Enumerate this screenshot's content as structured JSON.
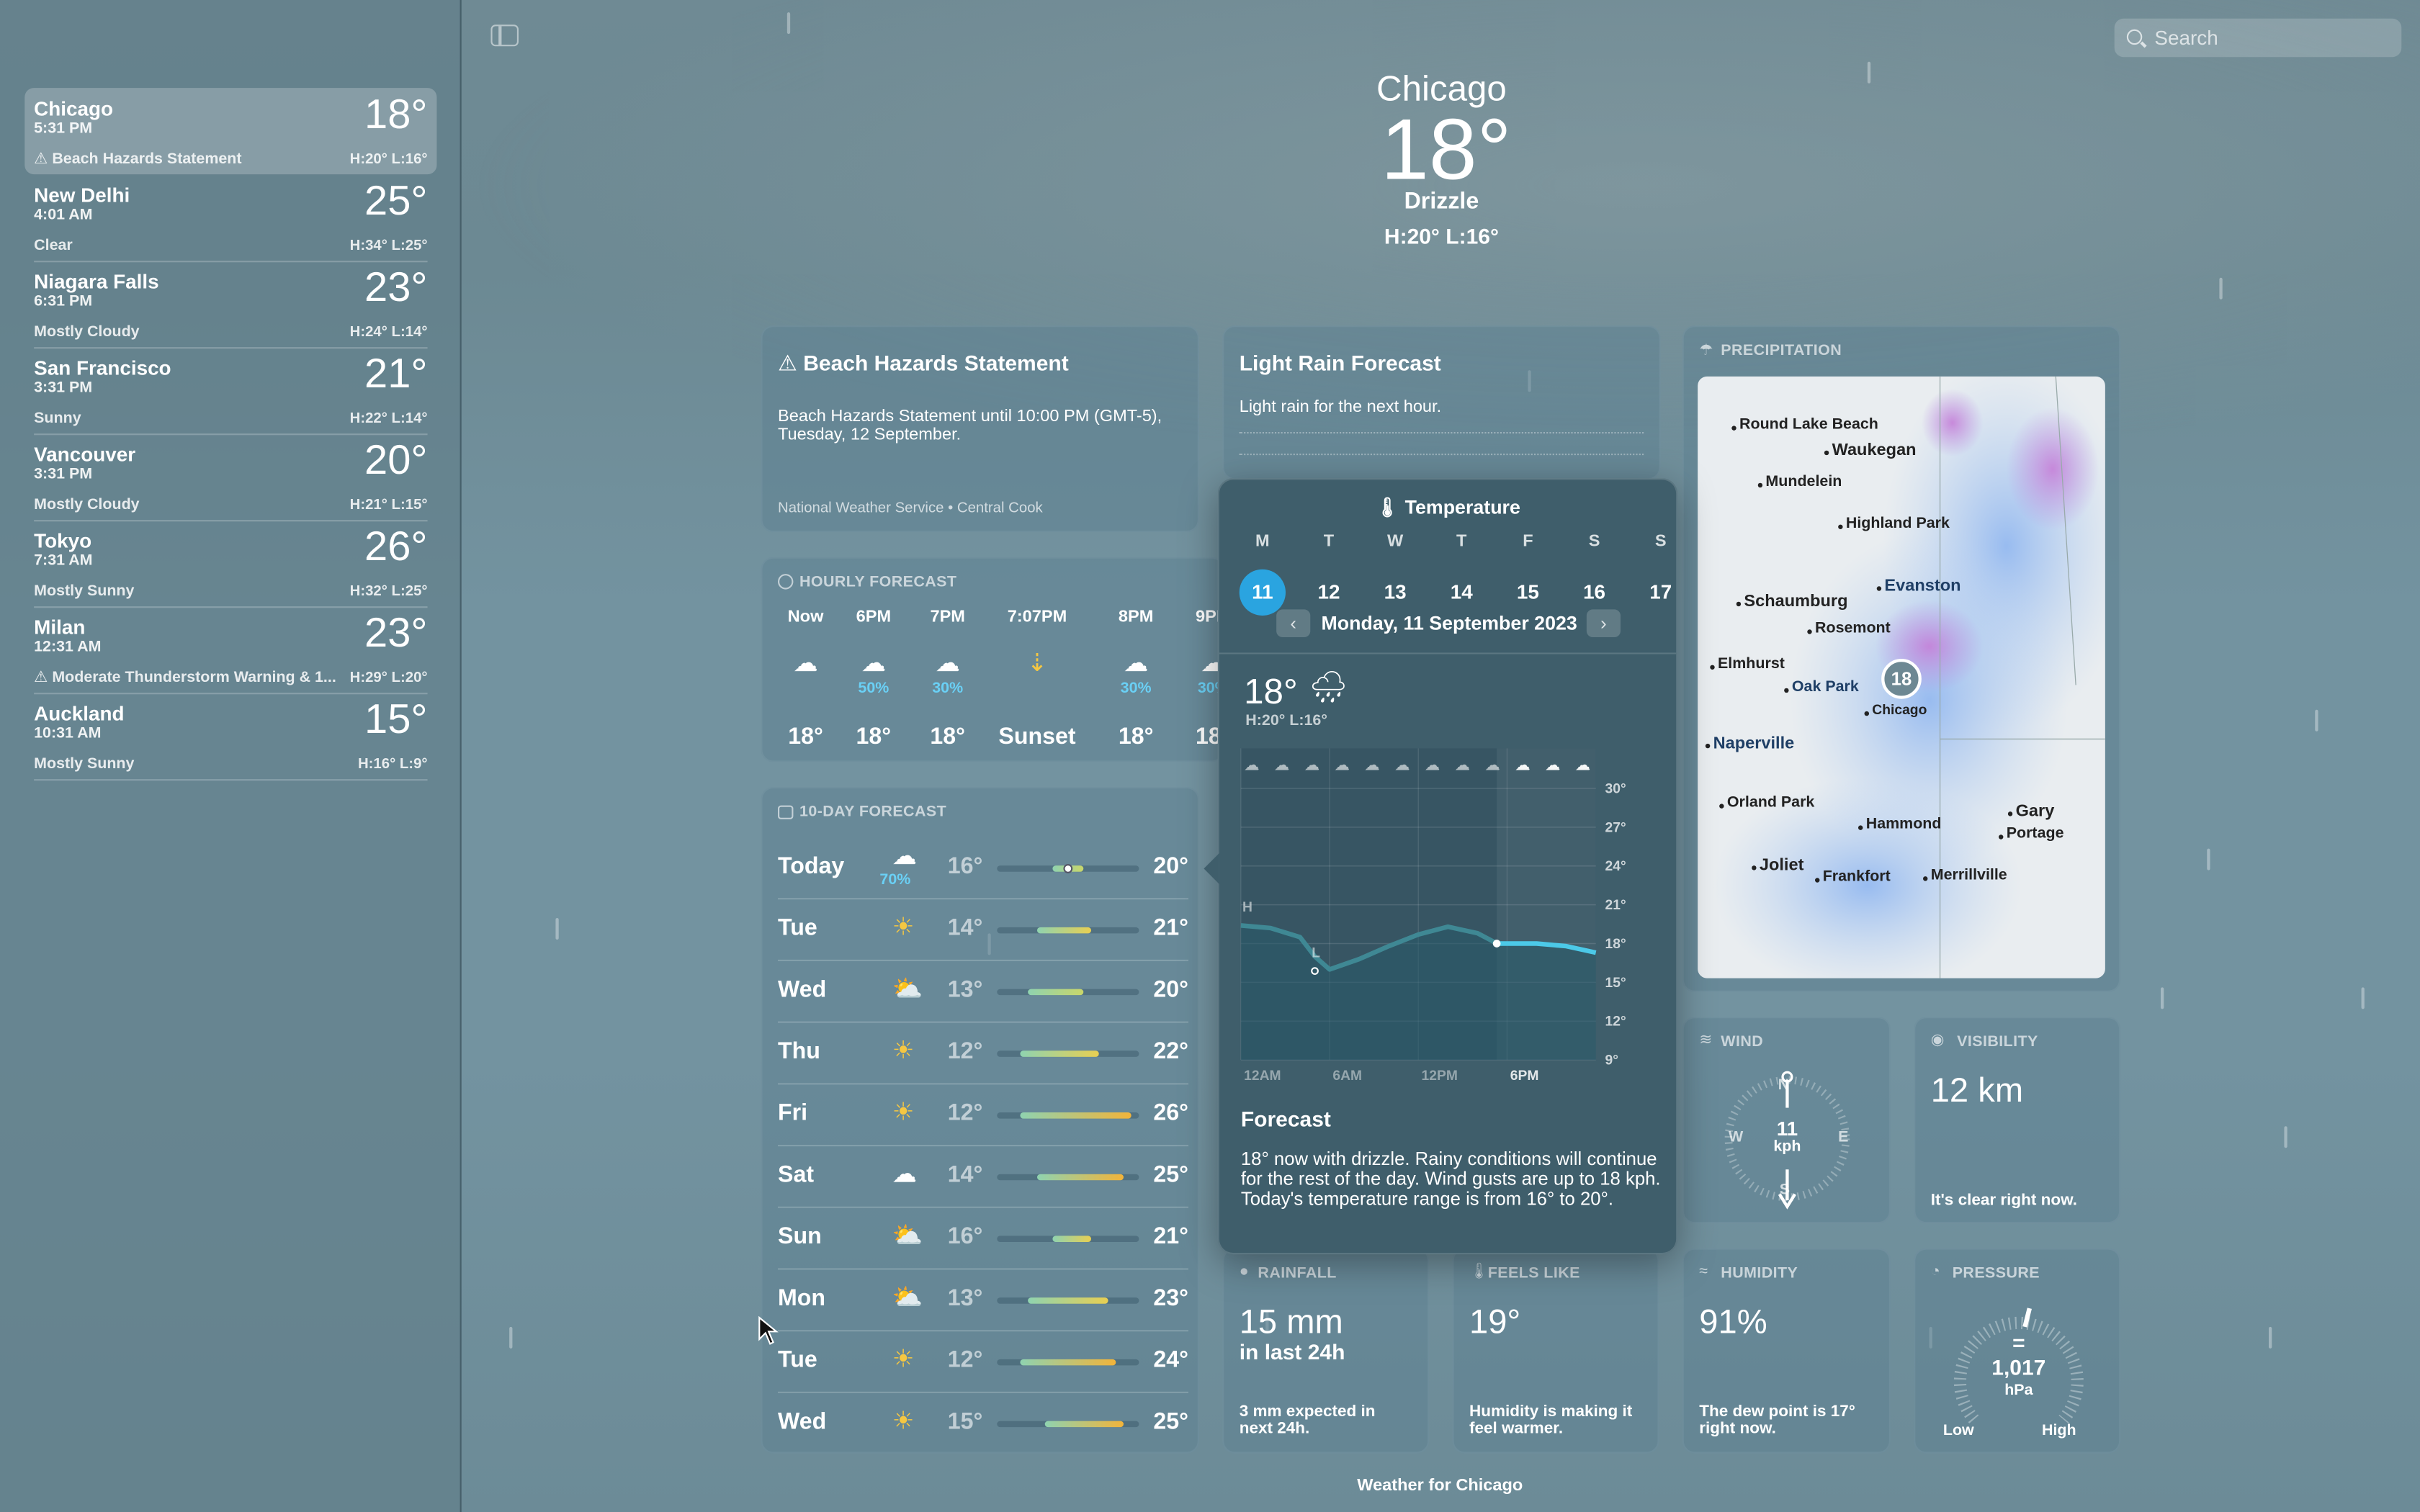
{
  "sidebar": {
    "cities": [
      {
        "name": "Chicago",
        "time": "5:31 PM",
        "temp": "18°",
        "condition": "Beach Hazards Statement",
        "hl": "H:20° L:16°",
        "alert": true
      },
      {
        "name": "New Delhi",
        "time": "4:01 AM",
        "temp": "25°",
        "condition": "Clear",
        "hl": "H:34° L:25°",
        "alert": false
      },
      {
        "name": "Niagara Falls",
        "time": "6:31 PM",
        "temp": "23°",
        "condition": "Mostly Cloudy",
        "hl": "H:24° L:14°",
        "alert": false
      },
      {
        "name": "San Francisco",
        "time": "3:31 PM",
        "temp": "21°",
        "condition": "Sunny",
        "hl": "H:22° L:14°",
        "alert": false
      },
      {
        "name": "Vancouver",
        "time": "3:31 PM",
        "temp": "20°",
        "condition": "Mostly Cloudy",
        "hl": "H:21° L:15°",
        "alert": false
      },
      {
        "name": "Tokyo",
        "time": "7:31 AM",
        "temp": "26°",
        "condition": "Mostly Sunny",
        "hl": "H:32° L:25°",
        "alert": false
      },
      {
        "name": "Milan",
        "time": "12:31 AM",
        "temp": "23°",
        "condition": "Moderate Thunderstorm Warning & 1...",
        "hl": "H:29° L:20°",
        "alert": true
      },
      {
        "name": "Auckland",
        "time": "10:31 AM",
        "temp": "15°",
        "condition": "Mostly Sunny",
        "hl": "H:16° L:9°",
        "alert": false
      }
    ]
  },
  "search": {
    "placeholder": "Search"
  },
  "header": {
    "city": "Chicago",
    "temp": "18°",
    "condition": "Drizzle",
    "hl": "H:20°  L:16°"
  },
  "alert_card": {
    "title": "Beach Hazards Statement",
    "body": "Beach Hazards Statement until 10:00 PM (GMT-5), Tuesday, 12 September.",
    "source": "National Weather Service • Central Cook"
  },
  "rain_card": {
    "title": "Light Rain Forecast",
    "body": "Light rain for the next hour."
  },
  "hourly": {
    "title": "HOURLY FORECAST",
    "hours": [
      {
        "label": "Now",
        "icon": "cloud-icon",
        "pop": "",
        "temp": "18°"
      },
      {
        "label": "6PM",
        "icon": "rain-cloud-icon",
        "pop": "50%",
        "temp": "18°"
      },
      {
        "label": "7PM",
        "icon": "rain-cloud-icon",
        "pop": "30%",
        "temp": "18°"
      },
      {
        "label": "7:07PM",
        "icon": "sunset-icon",
        "pop": "",
        "temp": "Sunset"
      },
      {
        "label": "8PM",
        "icon": "moon-cloud-icon",
        "pop": "30%",
        "temp": "18°"
      },
      {
        "label": "9PM",
        "icon": "rain-cloud-icon",
        "pop": "30%",
        "temp": "18°"
      }
    ]
  },
  "ten_day": {
    "title": "10-DAY FORECAST",
    "days": [
      {
        "day": "Today",
        "icon": "rain-cloud-icon",
        "pop": "70%",
        "lo": "16°",
        "hi": "20°",
        "lo_v": 16,
        "hi_v": 20,
        "current": 18
      },
      {
        "day": "Tue",
        "icon": "sun-icon",
        "pop": "",
        "lo": "14°",
        "hi": "21°",
        "lo_v": 14,
        "hi_v": 21
      },
      {
        "day": "Wed",
        "icon": "partly-cloudy-icon",
        "pop": "",
        "lo": "13°",
        "hi": "20°",
        "lo_v": 13,
        "hi_v": 20
      },
      {
        "day": "Thu",
        "icon": "sun-icon",
        "pop": "",
        "lo": "12°",
        "hi": "22°",
        "lo_v": 12,
        "hi_v": 22
      },
      {
        "day": "Fri",
        "icon": "sun-icon",
        "pop": "",
        "lo": "12°",
        "hi": "26°",
        "lo_v": 12,
        "hi_v": 26
      },
      {
        "day": "Sat",
        "icon": "cloud-icon",
        "pop": "",
        "lo": "14°",
        "hi": "25°",
        "lo_v": 14,
        "hi_v": 25
      },
      {
        "day": "Sun",
        "icon": "partly-cloudy-icon",
        "pop": "",
        "lo": "16°",
        "hi": "21°",
        "lo_v": 16,
        "hi_v": 21
      },
      {
        "day": "Mon",
        "icon": "partly-cloudy-icon",
        "pop": "",
        "lo": "13°",
        "hi": "23°",
        "lo_v": 13,
        "hi_v": 23
      },
      {
        "day": "Tue",
        "icon": "sun-icon",
        "pop": "",
        "lo": "12°",
        "hi": "24°",
        "lo_v": 12,
        "hi_v": 24
      },
      {
        "day": "Wed",
        "icon": "sun-icon",
        "pop": "",
        "lo": "15°",
        "hi": "25°",
        "lo_v": 15,
        "hi_v": 25
      }
    ]
  },
  "popover": {
    "title": "Temperature",
    "weekdays": [
      "M",
      "T",
      "W",
      "T",
      "F",
      "S",
      "S"
    ],
    "dates": [
      "11",
      "12",
      "13",
      "14",
      "15",
      "16",
      "17"
    ],
    "selected_index": 0,
    "date_label": "Monday, 11 September 2023",
    "temp": "18°",
    "hl": "H:20° L:16°",
    "y_ticks": [
      "30°",
      "27°",
      "24°",
      "21°",
      "18°",
      "15°",
      "12°",
      "9°"
    ],
    "x_ticks": [
      "12AM",
      "6AM",
      "12PM",
      "6PM"
    ],
    "h_marker": "H",
    "l_marker": "L",
    "forecast_title": "Forecast",
    "forecast_text": "18° now with drizzle. Rainy conditions will continue for the rest of the day. Wind gusts are up to 18 kph. Today's temperature range is from 16° to 20°."
  },
  "chart_data": {
    "type": "line",
    "title": "Temperature",
    "x": [
      "12AM",
      "2AM",
      "4AM",
      "5AM",
      "6AM",
      "8AM",
      "10AM",
      "12PM",
      "2PM",
      "4PM",
      "5PM",
      "6PM",
      "8PM",
      "10PM",
      "12AM"
    ],
    "x_hours": [
      0,
      2,
      4,
      5,
      6,
      8,
      10,
      12,
      14,
      16,
      17,
      18,
      20,
      22,
      24
    ],
    "series": [
      {
        "values": [
          19.4,
          19.2,
          18.5,
          17.0,
          16.0,
          16.8,
          17.8,
          18.7,
          19.3,
          18.8,
          18.2,
          18.0,
          18.0,
          17.8,
          17.3
        ]
      }
    ],
    "current_hour": 17.3,
    "ylim": [
      9,
      30
    ],
    "y_ticks": [
      9,
      12,
      15,
      18,
      21,
      24,
      27,
      30
    ],
    "grid": true
  },
  "precipitation": {
    "title": "PRECIPITATION",
    "map_places": [
      "Round Lake Beach",
      "Waukegan",
      "Mundelein",
      "Highland Park",
      "Schaumburg",
      "Evanston",
      "Rosemont",
      "Elmhurst",
      "Oak Park",
      "Naperville",
      "Chicago",
      "Orland Park",
      "Hammond",
      "Gary",
      "Portage",
      "Joliet",
      "Frankfort",
      "Merrillville"
    ],
    "pin_temp": "18"
  },
  "wind": {
    "title": "WIND",
    "speed": "11",
    "unit": "kph",
    "n": "N",
    "e": "E",
    "s": "S",
    "w": "W"
  },
  "visibility": {
    "title": "VISIBILITY",
    "value": "12 km",
    "note": "It's clear right now."
  },
  "rainfall": {
    "title": "RAINFALL",
    "value": "15 mm",
    "sub": "in last 24h",
    "note": "3 mm expected in next 24h."
  },
  "feels": {
    "title": "FEELS LIKE",
    "value": "19°",
    "note": "Humidity is making it feel warmer."
  },
  "humidity": {
    "title": "HUMIDITY",
    "value": "91%",
    "note": "The dew point is 17° right now."
  },
  "pressure": {
    "title": "PRESSURE",
    "eq": "=",
    "value": "1,017",
    "unit": "hPa",
    "low": "Low",
    "high": "High"
  },
  "footer": {
    "text": "Weather for Chicago"
  },
  "colors": {
    "accent": "#2aa4e0",
    "line": "#4cc9e8"
  }
}
